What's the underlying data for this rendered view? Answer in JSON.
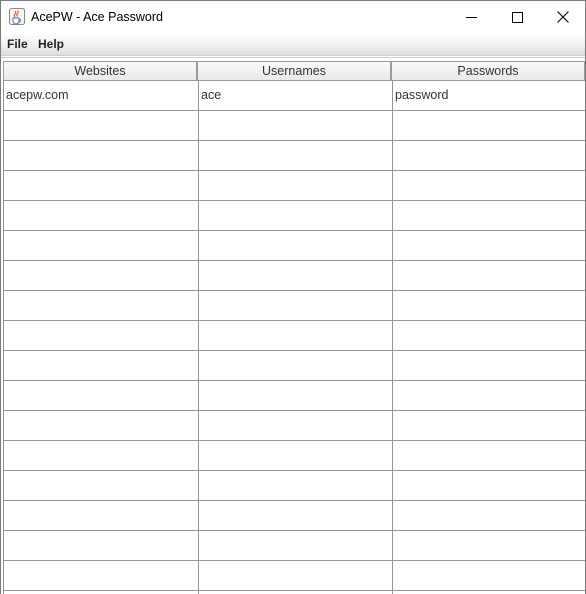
{
  "window": {
    "title": "AcePW - Ace Password",
    "icon": "java-coffee-icon",
    "controls": [
      "minimize-icon",
      "maximize-icon",
      "close-icon"
    ]
  },
  "menu": {
    "items": [
      {
        "label": "File"
      },
      {
        "label": "Help"
      }
    ]
  },
  "table": {
    "columns": [
      "Websites",
      "Usernames",
      "Passwords"
    ],
    "rows": [
      [
        "acepw.com",
        "ace",
        "password"
      ],
      [
        "",
        "",
        ""
      ],
      [
        "",
        "",
        ""
      ],
      [
        "",
        "",
        ""
      ],
      [
        "",
        "",
        ""
      ],
      [
        "",
        "",
        ""
      ],
      [
        "",
        "",
        ""
      ],
      [
        "",
        "",
        ""
      ],
      [
        "",
        "",
        ""
      ],
      [
        "",
        "",
        ""
      ],
      [
        "",
        "",
        ""
      ],
      [
        "",
        "",
        ""
      ],
      [
        "",
        "",
        ""
      ],
      [
        "",
        "",
        ""
      ],
      [
        "",
        "",
        ""
      ],
      [
        "",
        "",
        ""
      ],
      [
        "",
        "",
        ""
      ],
      [
        "",
        "",
        ""
      ]
    ]
  }
}
